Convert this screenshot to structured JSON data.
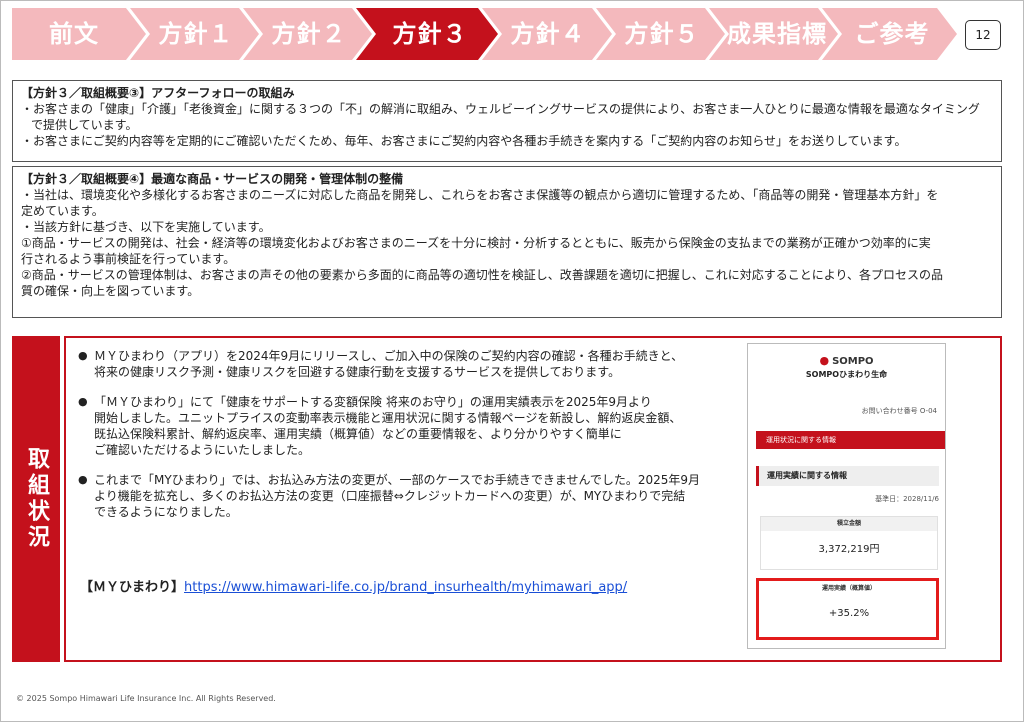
{
  "nav": {
    "items": [
      {
        "label": "前文",
        "active": false
      },
      {
        "label": "方針１",
        "active": false
      },
      {
        "label": "方針２",
        "active": false
      },
      {
        "label": "方針３",
        "active": true
      },
      {
        "label": "方針４",
        "active": false
      },
      {
        "label": "方針５",
        "active": false
      },
      {
        "label": "成果指標",
        "active": false
      },
      {
        "label": "ご参考",
        "active": false
      }
    ],
    "page_number": "12",
    "colors": {
      "inactive": "#f4b9bd",
      "active": "#c4111c"
    }
  },
  "box1": {
    "heading": "【方針３／取組概要③】アフターフォローの取組み",
    "lines": [
      "・お客さまの「健康」「介護」「老後資金」に関する３つの「不」の解消に取組み、ウェルビーイングサービスの提供により、お客さま一人ひとりに最適な情報を最適なタイミング",
      "で提供しています。",
      "・お客さまにご契約内容等を定期的にご確認いただくため、毎年、お客さまにご契約内容や各種お手続きを案内する「ご契約内容のお知らせ」をお送りしています。"
    ]
  },
  "box2": {
    "heading": "【方針３／取組概要④】最適な商品・サービスの開発・管理体制の整備",
    "lines": [
      "・当社は、環境変化や多様化するお客さまのニーズに対応した商品を開発し、これらをお客さま保護等の観点から適切に管理するため、「商品等の開発・管理基本方針」を",
      "定めています。",
      "・当該方針に基づき、以下を実施しています。",
      "①商品・サービスの開発は、社会・経済等の環境変化およびお客さまのニーズを十分に検討・分析するとともに、販売から保険金の支払までの業務が正確かつ効率的に実",
      "行されるよう事前検証を行っています。",
      "②商品・サービスの管理体制は、お客さまの声その他の要素から多面的に商品等の適切性を検証し、改善課題を適切に把握し、これに対応することにより、各プロセスの品",
      "質の確保・向上を図っています。"
    ]
  },
  "status": {
    "tab_label": "取組状況",
    "bullets": [
      {
        "lines": [
          "ＭＹひまわり（アプリ）を2024年9月にリリースし、ご加入中の保険のご契約内容の確認・各種お手続きと、",
          "将来の健康リスク予測・健康リスクを回避する健康行動を支援するサービスを提供しております。"
        ]
      },
      {
        "lines": [
          "「ＭＹひまわり」にて「健康をサポートする変額保険 将来のお守り」の運用実績表示を2025年9月より",
          "開始しました。ユニットプライスの変動率表示機能と運用状況に関する情報ページを新設し、解約返戻金額、",
          "既払込保険料累計、解約返戻率、運用実績（概算値）などの重要情報を、より分かりやすく簡単に",
          "ご確認いただけるようにいたしました。"
        ]
      },
      {
        "lines": [
          "これまで「MYひまわり」では、お払込み方法の変更が、一部のケースでお手続きできませんでした。2025年9月",
          "より機能を拡充し、多くのお払込方法の変更（口座振替⇔クレジットカードへの変更）が、MYひまわりで完結",
          "できるようになりました。"
        ]
      }
    ],
    "link_label": "【ＭＹひまわり】",
    "link_url": "https://www.himawari-life.co.jp/brand_insurhealth/myhimawari_app/"
  },
  "phone": {
    "brand": "SOMPO",
    "company": "SOMPOひまわり生命",
    "inquiry": "お問い合わせ番号 O-04",
    "red_bar": "運用状況に関する情報",
    "section": "運用実績に関する情報",
    "date": "基準日：2028/11/6",
    "cards": [
      {
        "caption": "積立金額",
        "value": "3,372,219円"
      },
      {
        "caption": "運用実績（概算値）",
        "value": "+35.2%"
      }
    ]
  },
  "footer": "© 2025 Sompo Himawari Life Insurance Inc. All Rights Reserved."
}
